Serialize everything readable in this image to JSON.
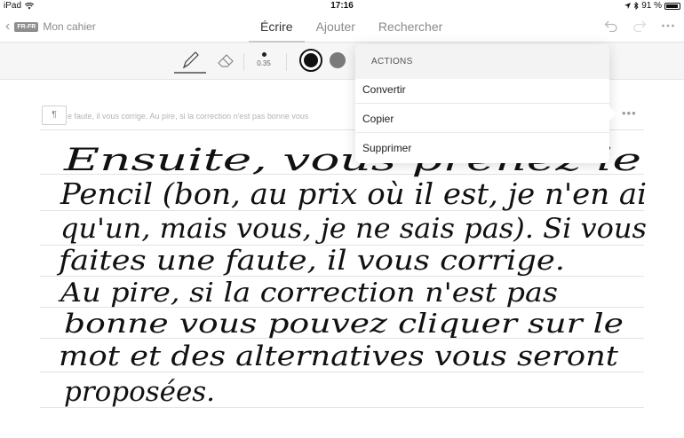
{
  "status_bar": {
    "device": "iPad",
    "time": "17:16",
    "battery": "91 %"
  },
  "nav": {
    "lang_badge": "FR-FR",
    "back_label": "Mon cahier",
    "tabs": [
      {
        "label": "Écrire",
        "active": true
      },
      {
        "label": "Ajouter",
        "active": false
      },
      {
        "label": "Rechercher",
        "active": false
      }
    ],
    "icons": [
      "undo-icon",
      "redo-icon",
      "more-icon"
    ]
  },
  "toolbar": {
    "tools": [
      "pen-icon",
      "eraser-icon"
    ],
    "pen_size": "0.35",
    "colors": [
      "#111111",
      "#7a7a7a"
    ]
  },
  "note": {
    "paragraph_symbol": "¶",
    "conversion_preview": "e faute, il vous corrige. Au pire, si la correction n'est pas bonne vous",
    "more_label": "•••",
    "handwriting_lines": [
      "Ensuite, vous prenez le",
      "Pencil (bon, au prix où il est, je n'en ai",
      "qu'un, mais vous, je ne sais pas). Si vous",
      "faites une faute, il vous corrige.",
      "Au pire, si la correction n'est pas",
      "bonne vous pouvez cliquer sur le",
      "mot et des alternatives vous seront",
      "proposées."
    ]
  },
  "actions_menu": {
    "header": "ACTIONS",
    "items": [
      "Convertir",
      "Copier",
      "Supprimer"
    ]
  }
}
